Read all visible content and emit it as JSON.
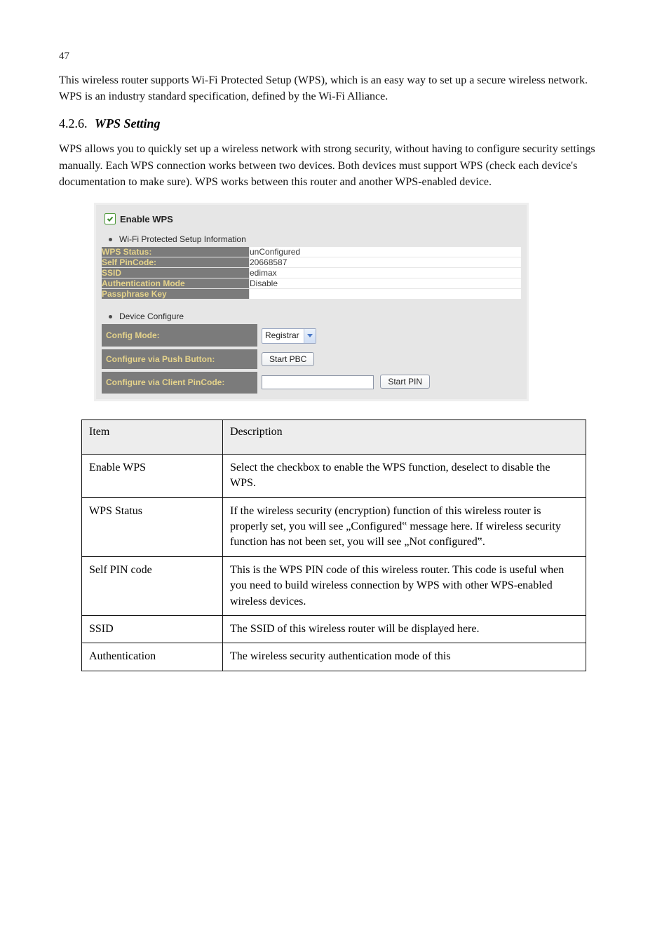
{
  "page_number": "47",
  "intro_text": "This wireless router supports Wi-Fi Protected Setup (WPS), which is an easy way to set up a secure wireless network. WPS is an industry standard specification, defined by the Wi-Fi Alliance.",
  "supports_text": "WPS allows you to quickly set up a wireless network with strong security, without having to configure security settings manually. Each WPS connection works between two devices. Both devices must support WPS (check each device's documentation to make sure). WPS works between this router and another WPS-enabled device.",
  "section_number": "4.2.6.",
  "section_title": "WPS Setting",
  "panel": {
    "enable_label": "Enable WPS",
    "enable_checked": true,
    "sec1_title": "Wi-Fi Protected Setup Information",
    "rows": [
      {
        "label": "WPS Status:",
        "value": "unConfigured"
      },
      {
        "label": "Self PinCode:",
        "value": "20668587"
      },
      {
        "label": "SSID",
        "value": "edimax"
      },
      {
        "label": "Authentication Mode",
        "value": "Disable"
      },
      {
        "label": "Passphrase Key",
        "value": ""
      }
    ],
    "sec2_title": "Device Configure",
    "config_mode_label": "Config Mode:",
    "config_mode_value": "Registrar",
    "push_label": "Configure via Push Button:",
    "push_button": "Start PBC",
    "pin_label": "Configure via Client PinCode:",
    "pin_input_value": "",
    "pin_button": "Start PIN"
  },
  "desc_header_item": "Item",
  "desc_header_desc": "Description",
  "desc_rows": [
    {
      "item": "Enable WPS",
      "desc": "Select the checkbox to enable the WPS function, deselect to disable the WPS."
    },
    {
      "item": "WPS Status",
      "desc": "If the wireless security (encryption) function of this wireless router is properly set, you will see „Configured‟ message here. If wireless security function has not been set, you will see „Not configured‟."
    },
    {
      "item": "Self PIN code",
      "desc": "This is the WPS PIN code of this wireless router. This code is useful when you need to build wireless connection by WPS with other WPS-enabled wireless devices."
    },
    {
      "item": "SSID",
      "desc": "The SSID of this wireless router will be displayed here."
    },
    {
      "item": "Authentication",
      "desc": "The wireless security authentication mode of this"
    }
  ]
}
